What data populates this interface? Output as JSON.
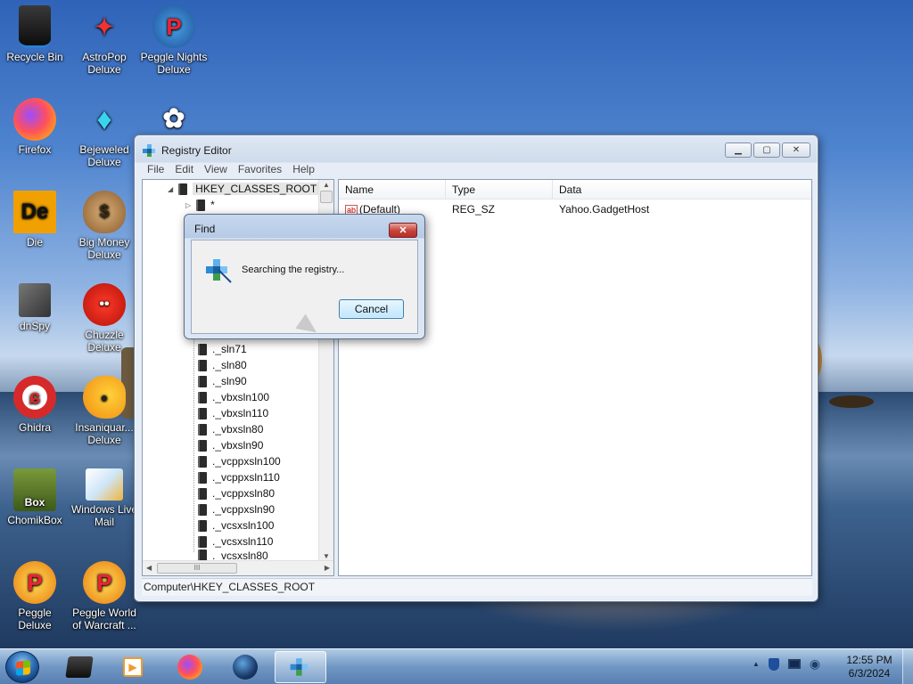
{
  "desktop": {
    "icons": [
      {
        "label": "Recycle Bin",
        "icon": "recycle-bin-icon"
      },
      {
        "label": "AstroPop Deluxe",
        "icon": "astropop-icon"
      },
      {
        "label": "Peggle Nights Deluxe",
        "icon": "peggle-nights-icon"
      },
      {
        "label": "Firefox",
        "icon": "firefox-icon"
      },
      {
        "label": "Bejeweled Deluxe",
        "icon": "bejeweled-icon"
      },
      {
        "label": "Die",
        "icon": "die-icon"
      },
      {
        "label": "Big Money Deluxe",
        "icon": "big-money-icon"
      },
      {
        "label": "dnSpy",
        "icon": "dnspy-icon"
      },
      {
        "label": "Chuzzle Deluxe",
        "icon": "chuzzle-icon"
      },
      {
        "label": "Ghidra",
        "icon": "ghidra-icon"
      },
      {
        "label": "Insaniquar... Deluxe",
        "icon": "insaniquarium-icon"
      },
      {
        "label": "ChomikBox",
        "icon": "chomikbox-icon"
      },
      {
        "label": "Windows Live Mail",
        "icon": "windows-live-mail-icon"
      },
      {
        "label": "Peggle Deluxe",
        "icon": "peggle-icon"
      },
      {
        "label": "Peggle World of Warcraft ...",
        "icon": "peggle-wow-icon"
      }
    ]
  },
  "regedit": {
    "title": "Registry Editor",
    "menu": [
      "File",
      "Edit",
      "View",
      "Favorites",
      "Help"
    ],
    "tree": {
      "root": "HKEY_CLASSES_ROOT",
      "first_child": "*",
      "items": [
        "._sln71",
        "._sln80",
        "._sln90",
        "._vbxsln100",
        "._vbxsln110",
        "._vbxsln80",
        "._vbxsln90",
        "._vcppxsln100",
        "._vcppxsln110",
        "._vcppxsln80",
        "._vcppxsln90",
        "._vcsxsln100",
        "._vcsxsln110",
        "._vcsxsln80"
      ]
    },
    "list": {
      "columns": [
        "Name",
        "Type",
        "Data"
      ],
      "rows": [
        {
          "name": "(Default)",
          "type": "REG_SZ",
          "data": "Yahoo.GadgetHost"
        }
      ]
    },
    "status": "Computer\\HKEY_CLASSES_ROOT"
  },
  "find_dialog": {
    "title": "Find",
    "close_glyph": "✕",
    "message": "Searching the registry...",
    "cancel_label": "Cancel"
  },
  "taskbar": {
    "clock_time": "12:55 PM",
    "clock_date": "6/3/2024",
    "tray_arrow": "▲"
  }
}
